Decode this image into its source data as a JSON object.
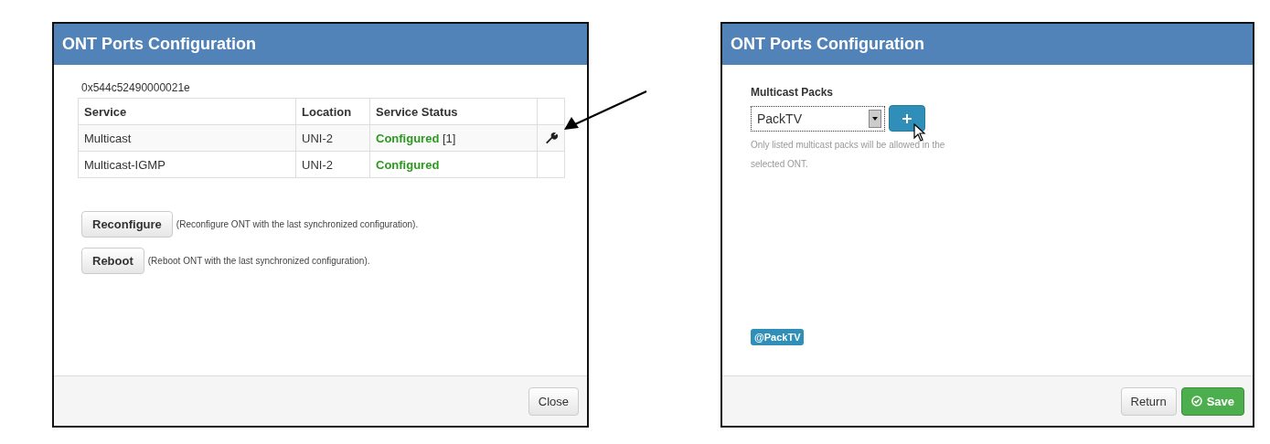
{
  "dialogs": [
    {
      "kind": "ports",
      "title": "ONT Ports Configuration",
      "ont_id": "0x544c52490000021e",
      "table": {
        "columns": [
          "Service",
          "Location",
          "Service Status"
        ],
        "rows": [
          {
            "service": "Multicast",
            "location": "UNI-2",
            "status": "Configured",
            "note": "[1]",
            "tool_icon": true
          },
          {
            "service": "Multicast-IGMP",
            "location": "UNI-2",
            "status": "Configured",
            "tool_icon": false
          }
        ]
      },
      "actions": [
        {
          "label": "Reconfigure",
          "description": "(Reconfigure ONT with the last synchronized configuration)."
        },
        {
          "label": "Reboot",
          "description": "(Reboot ONT with the last synchronized configuration)."
        }
      ],
      "footer_buttons": [
        {
          "label": "Close",
          "kind": "default"
        }
      ]
    },
    {
      "kind": "packs",
      "title": "ONT Ports Configuration",
      "field_label": "Multicast Packs",
      "select_value": "PackTV",
      "help": "Only listed multicast packs will be allowed in the selected ONT.",
      "tags": [
        "@PackTV"
      ],
      "footer_buttons": [
        {
          "label": "Return",
          "kind": "default"
        },
        {
          "label": "Save",
          "kind": "success"
        }
      ]
    }
  ]
}
